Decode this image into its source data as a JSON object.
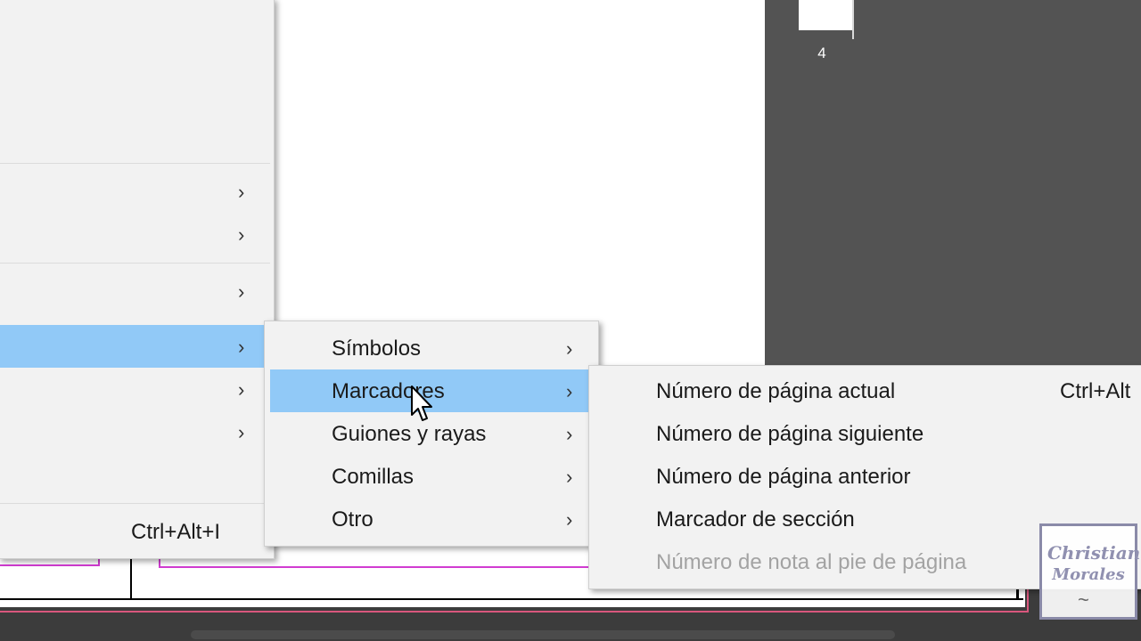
{
  "pages_panel": {
    "page_number": "4"
  },
  "main_menu": {
    "shortcut_row": {
      "shortcut": "Ctrl+Alt+I"
    }
  },
  "submenu_insert": {
    "items": [
      {
        "label": "Símbolos",
        "arrow": "›"
      },
      {
        "label": "Marcadores",
        "arrow": "›"
      },
      {
        "label": "Guiones y rayas",
        "arrow": "›"
      },
      {
        "label": "Comillas",
        "arrow": "›"
      },
      {
        "label": "Otro",
        "arrow": "›"
      }
    ]
  },
  "submenu_markers": {
    "items": [
      {
        "label": "Número de página actual",
        "shortcut": "Ctrl+Alt"
      },
      {
        "label": "Número de página siguiente"
      },
      {
        "label": "Número de página anterior"
      },
      {
        "label": "Marcador de sección"
      },
      {
        "label": "Número de nota al pie de página"
      }
    ]
  },
  "watermark": {
    "line1": "Christian",
    "line2": "Morales"
  },
  "arrow_glyph": "›",
  "colors": {
    "highlight": "#91c9f7",
    "guide": "#d13cd1",
    "panel": "#535353"
  }
}
